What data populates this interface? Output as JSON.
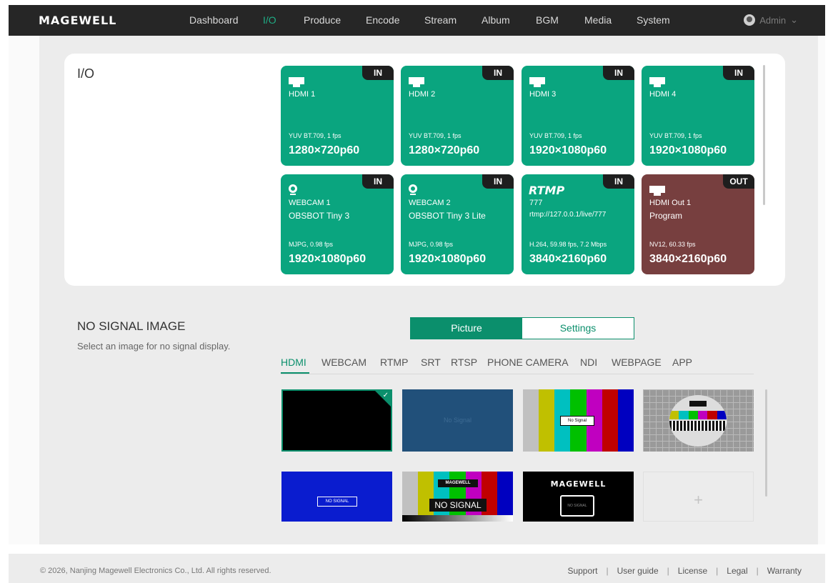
{
  "brand": "MAGEWELL",
  "nav": {
    "items": [
      {
        "label": "Dashboard"
      },
      {
        "label": "I/O"
      },
      {
        "label": "Produce"
      },
      {
        "label": "Encode"
      },
      {
        "label": "Stream"
      },
      {
        "label": "Album"
      },
      {
        "label": "BGM"
      },
      {
        "label": "Media"
      },
      {
        "label": "System"
      }
    ],
    "active": "I/O",
    "user": "Admin"
  },
  "io": {
    "title": "I/O",
    "tiles": [
      {
        "badge": "IN",
        "icon": "hdmi-icon",
        "name": "HDMI 1",
        "sub": "",
        "format": "YUV BT.709, 1 fps",
        "resolution": "1280×720p60"
      },
      {
        "badge": "IN",
        "icon": "hdmi-icon",
        "name": "HDMI 2",
        "sub": "",
        "format": "YUV BT.709, 1 fps",
        "resolution": "1280×720p60"
      },
      {
        "badge": "IN",
        "icon": "hdmi-icon",
        "name": "HDMI 3",
        "sub": "",
        "format": "YUV BT.709, 1 fps",
        "resolution": "1920×1080p60"
      },
      {
        "badge": "IN",
        "icon": "hdmi-icon",
        "name": "HDMI 4",
        "sub": "",
        "format": "YUV BT.709, 1 fps",
        "resolution": "1920×1080p60"
      },
      {
        "badge": "IN",
        "icon": "webcam-icon",
        "name": "WEBCAM 1",
        "sub": "OBSBOT Tiny 3",
        "format": "MJPG, 0.98 fps",
        "resolution": "1920×1080p60"
      },
      {
        "badge": "IN",
        "icon": "webcam-icon",
        "name": "WEBCAM 2",
        "sub": "OBSBOT Tiny 3 Lite",
        "format": "MJPG, 0.98 fps",
        "resolution": "1920×1080p60"
      },
      {
        "badge": "IN",
        "icon": "rtmp-logo",
        "logo_text": "RTMP",
        "name": "777",
        "sub": "rtmp://127.0.0.1/live/777",
        "format": "H.264, 59.98 fps, 7.2 Mbps",
        "resolution": "3840×2160p60"
      },
      {
        "badge": "OUT",
        "icon": "hdmi-icon",
        "name": "HDMI Out 1",
        "sub": "Program",
        "format": "NV12, 60.33 fps",
        "resolution": "3840×2160p60"
      }
    ]
  },
  "no_signal": {
    "title": "NO SIGNAL IMAGE",
    "description": "Select an image for no signal display.",
    "segments": {
      "picture": "Picture",
      "settings": "Settings"
    },
    "tabs": [
      "HDMI",
      "WEBCAM",
      "RTMP",
      "SRT",
      "RTSP",
      "PHONE CAMERA",
      "NDI",
      "WEBPAGE",
      "APP"
    ],
    "active_tab": "HDMI",
    "thumbnails": {
      "t2_text": "No Signal",
      "t3_text": "No Signal",
      "t5_text": "NO SIGNAL",
      "t6_brand": "MAGEWELL",
      "t6_text": "NO SIGNAL",
      "t7_brand": "MAGEWELL",
      "t7_text": "NO SIGNAL",
      "add": "+"
    },
    "selected_thumbnail": 1
  },
  "footer": {
    "copyright": "© 2026, Nanjing Magewell Electronics Co., Ltd. All rights reserved.",
    "links": [
      "Support",
      "User guide",
      "License",
      "Legal",
      "Warranty"
    ]
  },
  "colors": {
    "accent": "#0b8f6c",
    "tile_in": "#0aa57f",
    "tile_out": "#773f3f",
    "nav_bg": "#262626"
  }
}
